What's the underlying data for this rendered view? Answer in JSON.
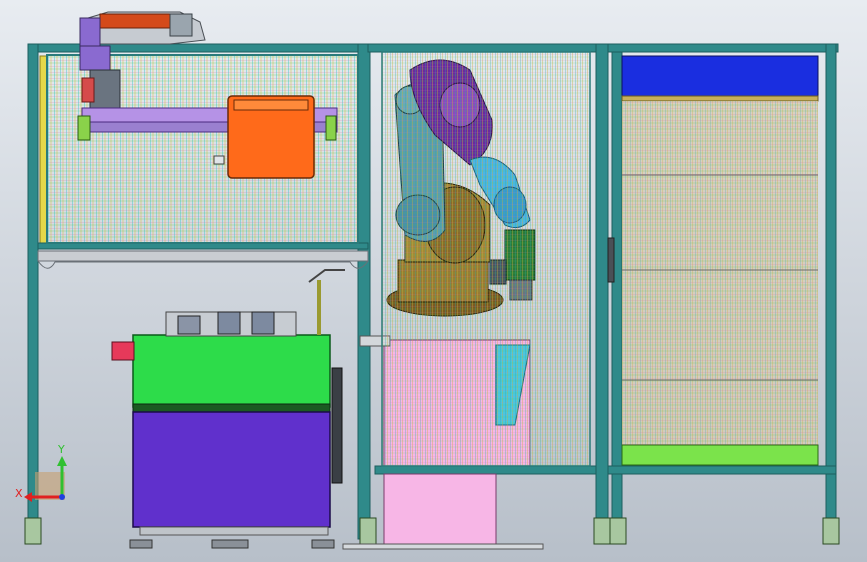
{
  "viewport": {
    "background_top": "#e8ecf1",
    "background_bottom": "#b7bfc9"
  },
  "colors": {
    "frame_post": "#2f8a8a",
    "frame_dark": "#1c5e5e",
    "mesh_cyan": "#33c8c8",
    "mesh_yellow": "#d9c33b",
    "mesh_pink": "#d47aa8",
    "mesh_green": "#59c94a",
    "mesh_blue": "#4b6be0",
    "robot_purple": "#6a2aa0",
    "robot_teal": "#4b8fa8",
    "robot_brown": "#8a6a2a",
    "robot_cyan": "#49b6e6",
    "machine_green": "#2ddc4a",
    "machine_purple": "#6030cc",
    "orange_unit": "#ff6a1a",
    "pink_base": "#f7b6e6",
    "shelf_blue": "#1a2ee0",
    "shelf_green": "#7be34b",
    "axis_x": "#e02020",
    "axis_y": "#30c030",
    "axis_z": "#2040e0"
  },
  "triad": {
    "x_label": "X",
    "y_label": "Y"
  }
}
